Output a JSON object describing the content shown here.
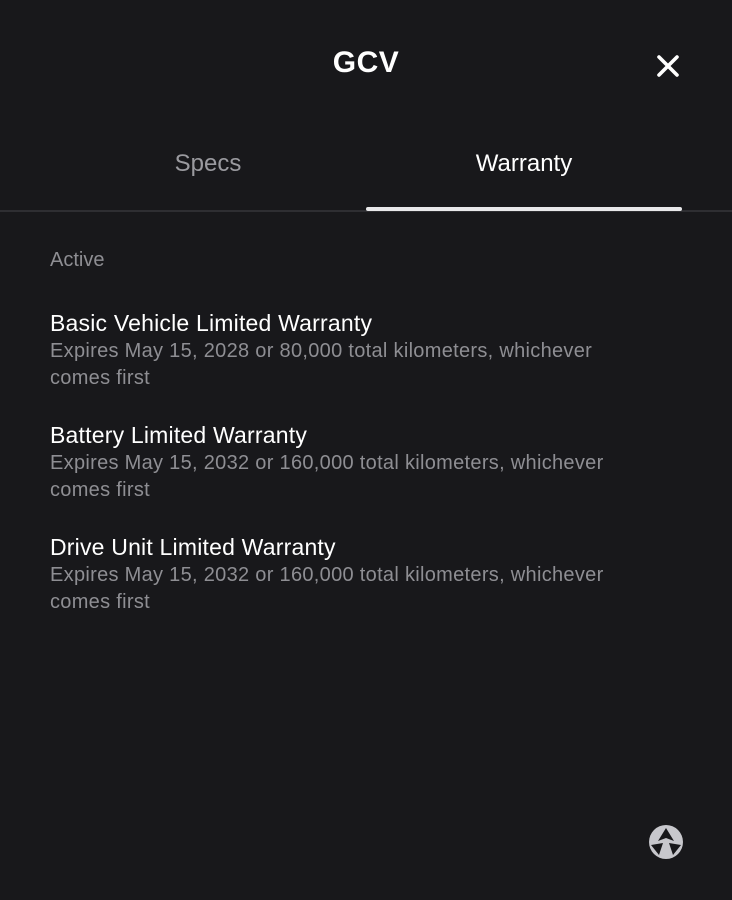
{
  "header": {
    "title": "GCV",
    "close_icon": "close-icon"
  },
  "tabs": [
    {
      "label": "Specs",
      "active": false
    },
    {
      "label": "Warranty",
      "active": true
    }
  ],
  "section": {
    "label": "Active",
    "items": [
      {
        "title": "Basic Vehicle Limited Warranty",
        "description": "Expires May 15, 2028 or 80,000 total kilometers, whichever comes first"
      },
      {
        "title": "Battery Limited Warranty",
        "description": "Expires May 15, 2032 or 160,000 total kilometers, whichever comes first"
      },
      {
        "title": "Drive Unit Limited Warranty",
        "description": "Expires May 15, 2032 or 160,000 total kilometers, whichever comes first"
      }
    ]
  },
  "colors": {
    "background": "#18181b",
    "primary_text": "#ffffff",
    "secondary_text": "#8e8e93",
    "active_tab_indicator": "#e8e8ea"
  },
  "footer": {
    "logo_icon": "assist-logo-icon"
  }
}
